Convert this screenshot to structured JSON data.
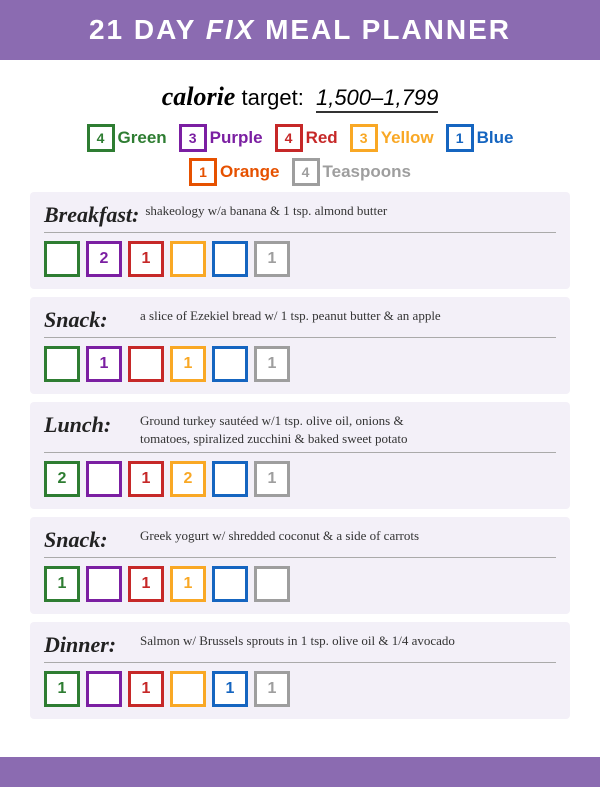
{
  "header": {
    "title_part1": "21 DAY ",
    "title_fix": "FIX",
    "title_part2": " MEAL PLANNER"
  },
  "calorie": {
    "word": "calorie",
    "target_label": "target:",
    "target_value": "1,500–1,799"
  },
  "containers": {
    "row1": [
      {
        "count": "4",
        "label": "Green",
        "color": "green"
      },
      {
        "count": "3",
        "label": "Purple",
        "color": "purple"
      },
      {
        "count": "4",
        "label": "Red",
        "color": "red"
      },
      {
        "count": "3",
        "label": "Yellow",
        "color": "yellow"
      },
      {
        "count": "1",
        "label": "Blue",
        "color": "blue"
      }
    ],
    "row2": [
      {
        "count": "1",
        "label": "Orange",
        "color": "orange"
      },
      {
        "count": "4",
        "label": "Teaspoons",
        "color": "gray"
      }
    ]
  },
  "meals": [
    {
      "id": "breakfast",
      "label": "Breakfast:",
      "description": "shakeology w/a banana & 1 tsp. almond butter",
      "boxes": [
        {
          "color": "green",
          "value": ""
        },
        {
          "color": "purple",
          "value": "2"
        },
        {
          "color": "red",
          "value": "1"
        },
        {
          "color": "yellow",
          "value": ""
        },
        {
          "color": "blue",
          "value": ""
        },
        {
          "color": "gray",
          "value": "1"
        }
      ]
    },
    {
      "id": "snack1",
      "label": "Snack:",
      "description": "a slice of Ezekiel bread w/ 1 tsp. peanut butter & an apple",
      "boxes": [
        {
          "color": "green",
          "value": ""
        },
        {
          "color": "purple",
          "value": "1"
        },
        {
          "color": "red",
          "value": ""
        },
        {
          "color": "yellow",
          "value": "1"
        },
        {
          "color": "blue",
          "value": ""
        },
        {
          "color": "gray",
          "value": "1"
        }
      ]
    },
    {
      "id": "lunch",
      "label": "Lunch:",
      "description": "Ground turkey sautéed w/1 tsp. olive oil, onions & tomatoes, spiralized zucchini & baked sweet potato",
      "boxes": [
        {
          "color": "green",
          "value": "2"
        },
        {
          "color": "purple",
          "value": ""
        },
        {
          "color": "red",
          "value": "1"
        },
        {
          "color": "yellow",
          "value": "2"
        },
        {
          "color": "blue",
          "value": ""
        },
        {
          "color": "gray",
          "value": "1"
        }
      ]
    },
    {
      "id": "snack2",
      "label": "Snack:",
      "description": "Greek yogurt w/ shredded coconut & a side of carrots",
      "boxes": [
        {
          "color": "green",
          "value": "1"
        },
        {
          "color": "purple",
          "value": ""
        },
        {
          "color": "red",
          "value": "1"
        },
        {
          "color": "yellow",
          "value": "1"
        },
        {
          "color": "blue",
          "value": ""
        },
        {
          "color": "gray",
          "value": ""
        }
      ]
    },
    {
      "id": "dinner",
      "label": "Dinner:",
      "description": "Salmon w/ Brussels sprouts in 1 tsp. olive oil & 1/4 avocado",
      "boxes": [
        {
          "color": "green",
          "value": "1"
        },
        {
          "color": "purple",
          "value": ""
        },
        {
          "color": "red",
          "value": "1"
        },
        {
          "color": "yellow",
          "value": ""
        },
        {
          "color": "blue",
          "value": "1"
        },
        {
          "color": "gray",
          "value": "1"
        }
      ]
    }
  ]
}
